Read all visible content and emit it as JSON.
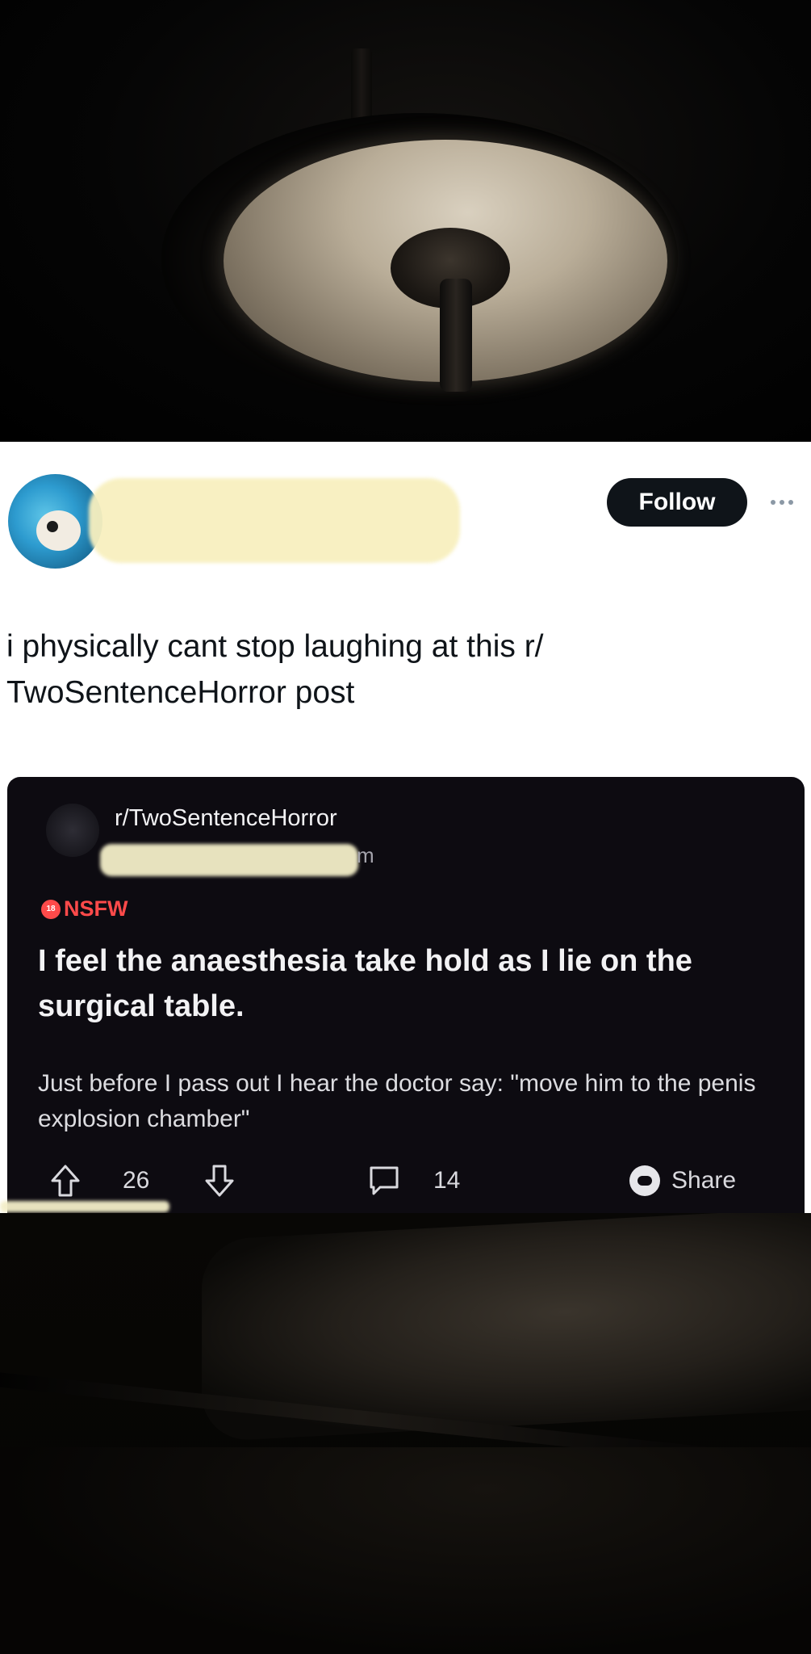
{
  "tweet": {
    "follow_label": "Follow",
    "text": "i physically cant stop laughing at this r/ TwoSentenceHorror post"
  },
  "reddit_post": {
    "subreddit": "r/TwoSentenceHorror",
    "time_ago": "m",
    "nsfw_label": "NSFW",
    "title": "I feel the anaesthesia take hold as I lie on the surgical table.",
    "body": "Just before I pass out I hear the doctor say: \"move him to the penis explosion chamber\"",
    "score": "26",
    "comment_count": "14",
    "share_label": "Share"
  },
  "icons": {
    "upvote": "arrow-up-icon",
    "downvote": "arrow-down-icon",
    "comment": "comment-bubble-icon",
    "share": "discord-share-icon",
    "more": "more-dots-icon"
  },
  "colors": {
    "follow_button_bg": "#0f1419",
    "nsfw_red": "#ff4a4a",
    "reddit_card_bg": "#0d0b11"
  }
}
